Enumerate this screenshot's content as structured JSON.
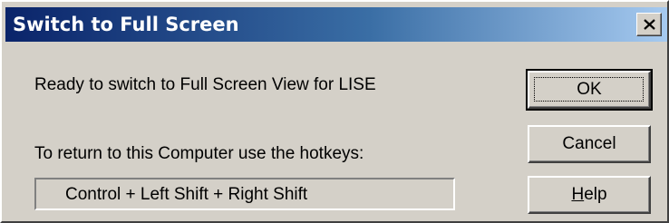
{
  "window": {
    "title": "Switch to Full Screen",
    "close_icon": "close-x-icon"
  },
  "content": {
    "message_ready": "Ready to switch to Full Screen View for LISE",
    "message_return": "To return to this Computer use the hotkeys:",
    "hotkey_combo": "Control + Left Shift + Right Shift"
  },
  "buttons": {
    "ok_label": "OK",
    "cancel_label": "Cancel",
    "help_mnemonic": "H",
    "help_rest": "elp"
  },
  "colors": {
    "title_gradient_start": "#0a246a",
    "title_gradient_end": "#a6caf0",
    "face": "#d4d0c8"
  }
}
